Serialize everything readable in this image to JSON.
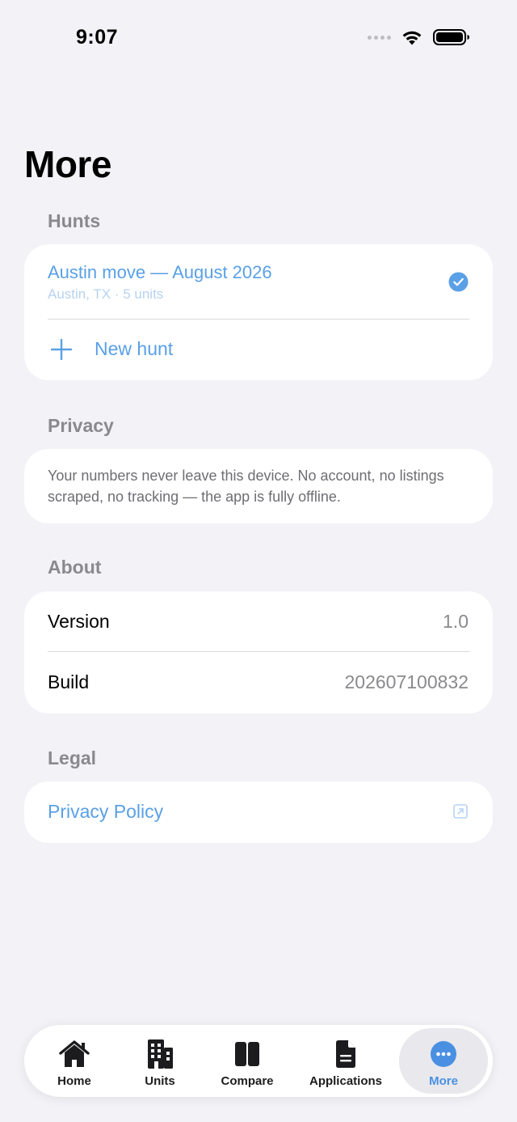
{
  "status_bar": {
    "time": "9:07"
  },
  "page": {
    "title": "More"
  },
  "sections": {
    "hunts": {
      "header": "Hunts",
      "items": [
        {
          "title": "Austin move — August 2026",
          "subtitle": "Austin, TX · 5 units",
          "selected": true
        }
      ],
      "new_hunt_label": "New hunt"
    },
    "privacy": {
      "header": "Privacy",
      "text": "Your numbers never leave this device. No account, no listings scraped, no tracking — the app is fully offline."
    },
    "about": {
      "header": "About",
      "rows": [
        {
          "key": "Version",
          "value": "1.0"
        },
        {
          "key": "Build",
          "value": "202607100832"
        }
      ]
    },
    "legal": {
      "header": "Legal",
      "privacy_policy_label": "Privacy Policy"
    }
  },
  "tab_bar": {
    "tabs": [
      {
        "label": "Home",
        "icon": "house-icon",
        "active": false
      },
      {
        "label": "Units",
        "icon": "building-icon",
        "active": false
      },
      {
        "label": "Compare",
        "icon": "split-rectangle-icon",
        "active": false
      },
      {
        "label": "Applications",
        "icon": "document-icon",
        "active": false
      },
      {
        "label": "More",
        "icon": "ellipsis-circle-icon",
        "active": true
      }
    ]
  },
  "colors": {
    "accent": "#5aa0e6",
    "background": "#f2f2f7",
    "card": "#ffffff",
    "secondary_text": "#8a8a8e"
  }
}
